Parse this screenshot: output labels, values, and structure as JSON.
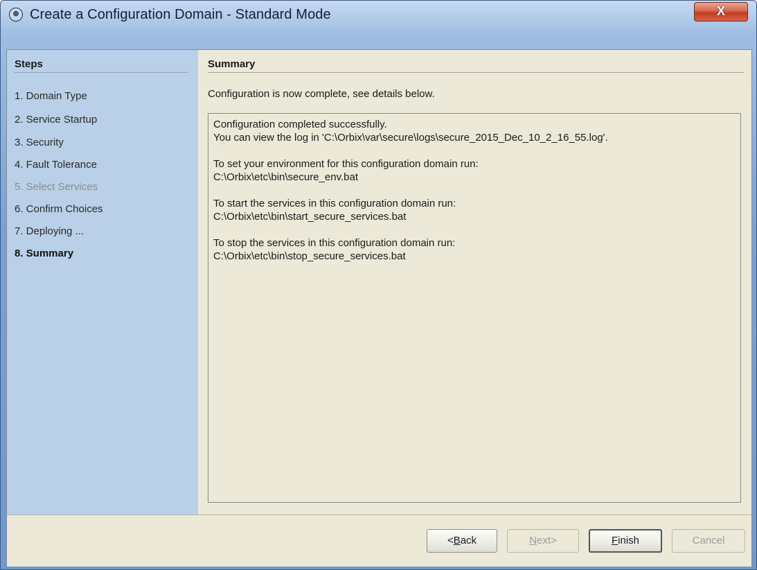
{
  "window": {
    "title": "Create a Configuration Domain - Standard Mode",
    "close_label": "X"
  },
  "steps": {
    "heading": "Steps",
    "items": [
      {
        "label": "1. Domain Type",
        "state": "normal"
      },
      {
        "label": "2. Service Startup",
        "state": "normal"
      },
      {
        "label": "3. Security",
        "state": "normal"
      },
      {
        "label": "4. Fault Tolerance",
        "state": "normal"
      },
      {
        "label": "5. Select Services",
        "state": "disabled"
      },
      {
        "label": "6. Confirm Choices",
        "state": "normal"
      },
      {
        "label": "7. Deploying ...",
        "state": "normal"
      },
      {
        "label": "8. Summary",
        "state": "current"
      }
    ]
  },
  "summary": {
    "heading": "Summary",
    "intro": "Configuration is now complete, see details below.",
    "lines": [
      "Configuration completed successfully.",
      "You can view the log in 'C:\\Orbix\\var\\secure\\logs\\secure_2015_Dec_10_2_16_55.log'.",
      "",
      "To set your environment for this configuration domain run:",
      "C:\\Orbix\\etc\\bin\\secure_env.bat",
      "",
      "To start the services in this configuration domain run:",
      "C:\\Orbix\\etc\\bin\\start_secure_services.bat",
      "",
      "To stop the services in this configuration domain run:",
      "C:\\Orbix\\etc\\bin\\stop_secure_services.bat"
    ]
  },
  "buttons": {
    "back": {
      "prefix": "<",
      "mnemonic": "B",
      "rest": "ack",
      "enabled": true
    },
    "next": {
      "prefix": "",
      "mnemonic": "N",
      "rest": "ext>",
      "enabled": false
    },
    "finish": {
      "prefix": "",
      "mnemonic": "F",
      "rest": "inish",
      "enabled": true
    },
    "cancel": {
      "label": "Cancel",
      "enabled": false
    }
  }
}
